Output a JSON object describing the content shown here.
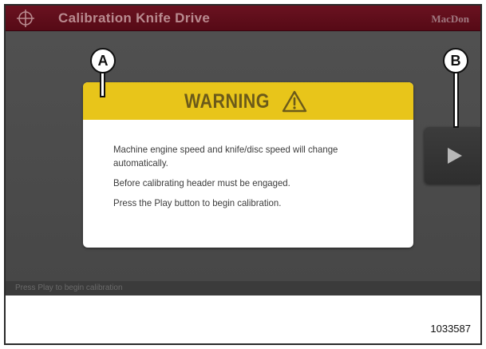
{
  "header": {
    "title": "Calibration Knife Drive",
    "brand": "MacDon"
  },
  "warning": {
    "title": "WARNING",
    "lines": [
      "Machine engine speed and knife/disc speed will change automatically.",
      "Before calibrating header must be engaged.",
      "Press the Play button to begin calibration."
    ]
  },
  "status": {
    "text": "Press Play to begin calibration"
  },
  "callouts": {
    "a": "A",
    "b": "B"
  },
  "figure": {
    "number": "1033587"
  },
  "icons": {
    "crosshair": "crosshair-icon",
    "warning": "warning-triangle-icon",
    "play": "play-icon"
  },
  "colors": {
    "titlebar": "#5e0e1a",
    "warning_header": "#e8c51a",
    "screen_bg": "#4b4b4b"
  }
}
